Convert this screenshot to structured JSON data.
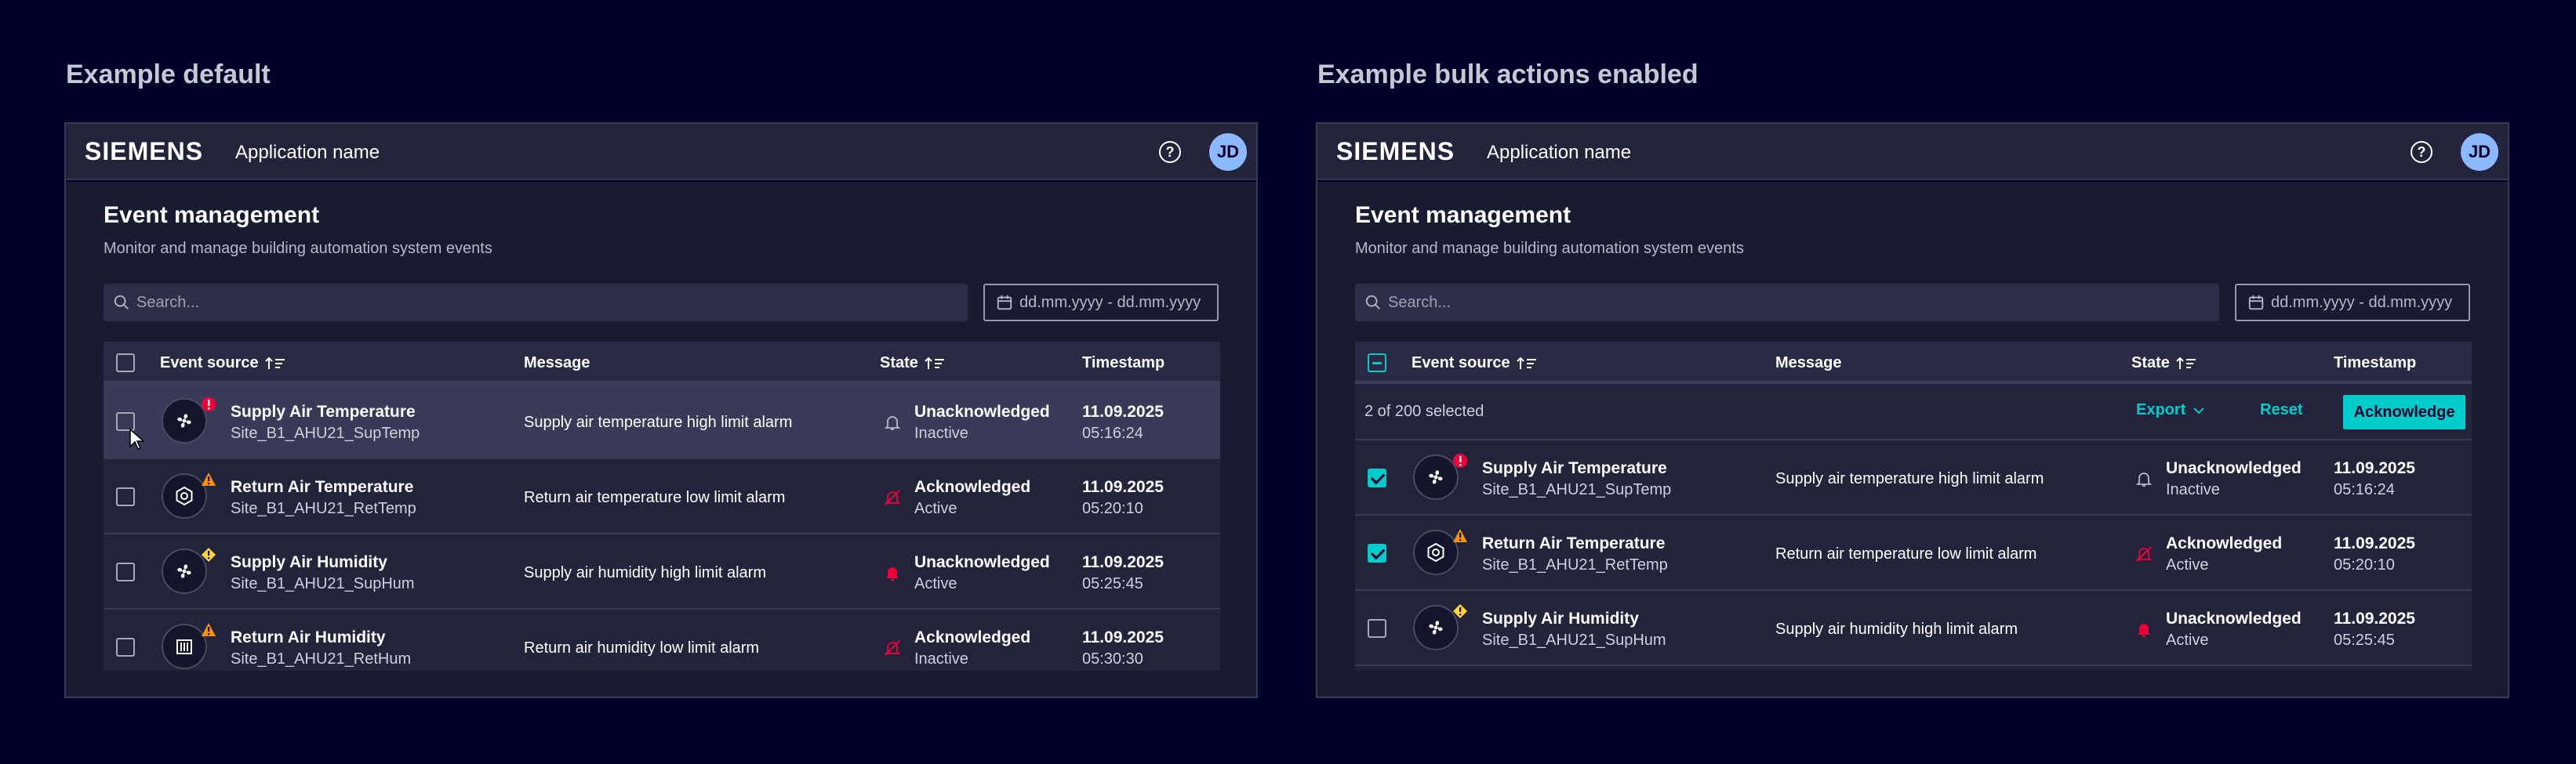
{
  "examples": [
    {
      "label": "Example default",
      "header": {
        "logo": "SIEMENS",
        "app_name": "Application name",
        "help_glyph": "?",
        "avatar_initials": "JD"
      },
      "page": {
        "title": "Event management",
        "subtitle": "Monitor and manage building automation system events"
      },
      "search": {
        "placeholder": "Search..."
      },
      "date_range": {
        "placeholder": "dd.mm.yyyy - dd.mm.yyyy"
      },
      "columns": {
        "source": "Event source",
        "message": "Message",
        "state": "State",
        "timestamp": "Timestamp"
      },
      "rows": [
        {
          "name": "Supply Air Temperature",
          "id": "Site_B1_AHU21_SupTemp",
          "message": "Supply air temperature high limit alarm",
          "state": "Unacknowledged",
          "substate": "Inactive",
          "date": "11.09.2025",
          "time": "05:16:24",
          "device_icon": "fan-icon",
          "severity": "high",
          "state_icon": "bell-outline-icon",
          "checked": false
        },
        {
          "name": "Return Air Temperature",
          "id": "Site_B1_AHU21_RetTemp",
          "message": "Return air temperature low limit alarm",
          "state": "Acknowledged",
          "substate": "Active",
          "date": "11.09.2025",
          "time": "05:20:10",
          "device_icon": "hex-gear-icon",
          "severity": "warning",
          "state_icon": "bell-muted-icon",
          "checked": false
        },
        {
          "name": "Supply Air Humidity",
          "id": "Site_B1_AHU21_SupHum",
          "message": "Supply air humidity high limit alarm",
          "state": "Unacknowledged",
          "substate": "Active",
          "date": "11.09.2025",
          "time": "05:25:45",
          "device_icon": "fan-icon",
          "severity": "caution",
          "state_icon": "bell-filled-icon",
          "checked": false
        },
        {
          "name": "Return Air Humidity",
          "id": "Site_B1_AHU21_RetHum",
          "message": "Return air humidity low limit alarm",
          "state": "Acknowledged",
          "substate": "Inactive",
          "date": "11.09.2025",
          "time": "05:30:30",
          "device_icon": "building-icon",
          "severity": "warning",
          "state_icon": "bell-muted-icon",
          "checked": false
        }
      ]
    },
    {
      "label": "Example bulk actions enabled",
      "header": {
        "logo": "SIEMENS",
        "app_name": "Application name",
        "help_glyph": "?",
        "avatar_initials": "JD"
      },
      "page": {
        "title": "Event management",
        "subtitle": "Monitor and manage building automation system events"
      },
      "search": {
        "placeholder": "Search..."
      },
      "date_range": {
        "placeholder": "dd.mm.yyyy - dd.mm.yyyy"
      },
      "columns": {
        "source": "Event source",
        "message": "Message",
        "state": "State",
        "timestamp": "Timestamp"
      },
      "bulk": {
        "count_text": "2 of 200 selected",
        "export_label": "Export",
        "reset_label": "Reset",
        "ack_label": "Acknowledge"
      },
      "rows": [
        {
          "name": "Supply Air Temperature",
          "id": "Site_B1_AHU21_SupTemp",
          "message": "Supply air temperature high limit alarm",
          "state": "Unacknowledged",
          "substate": "Inactive",
          "date": "11.09.2025",
          "time": "05:16:24",
          "device_icon": "fan-icon",
          "severity": "high",
          "state_icon": "bell-outline-icon",
          "checked": true
        },
        {
          "name": "Return Air Temperature",
          "id": "Site_B1_AHU21_RetTemp",
          "message": "Return air temperature low limit alarm",
          "state": "Acknowledged",
          "substate": "Active",
          "date": "11.09.2025",
          "time": "05:20:10",
          "device_icon": "hex-gear-icon",
          "severity": "warning",
          "state_icon": "bell-muted-icon",
          "checked": true
        },
        {
          "name": "Supply Air Humidity",
          "id": "Site_B1_AHU21_SupHum",
          "message": "Supply air humidity high limit alarm",
          "state": "Unacknowledged",
          "substate": "Active",
          "date": "11.09.2025",
          "time": "05:25:45",
          "device_icon": "fan-icon",
          "severity": "caution",
          "state_icon": "bell-filled-icon",
          "checked": false
        }
      ]
    }
  ],
  "colors": {
    "background": "#000028",
    "panel": "#1a1a32",
    "accent": "#00cccc",
    "danger": "#ef0137",
    "warning": "#ff9000",
    "caution": "#ffd732",
    "avatar": "#8cb8ff"
  }
}
